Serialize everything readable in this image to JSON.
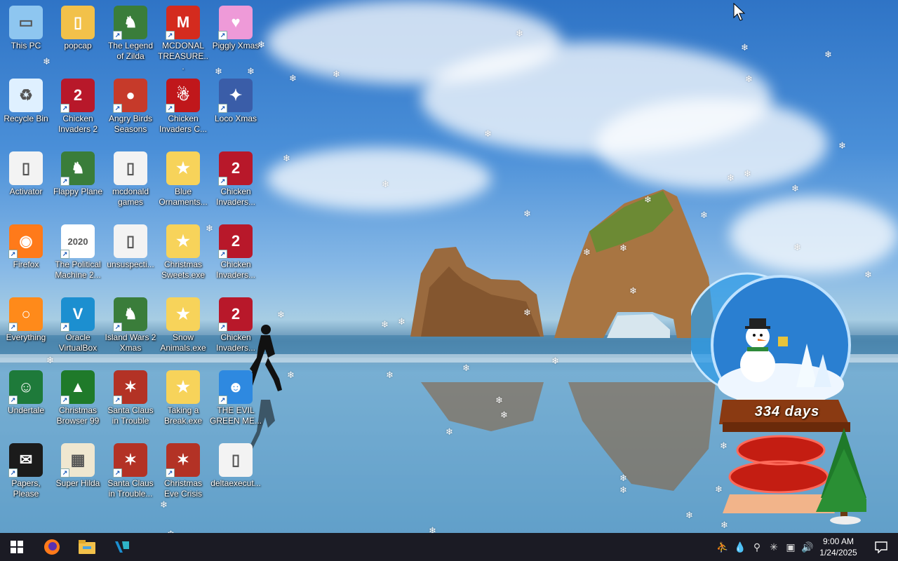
{
  "desktop": {
    "icons": [
      {
        "label": "This PC",
        "icon": "computer-icon",
        "shortcut": false
      },
      {
        "label": "popcap",
        "icon": "folder-icon",
        "shortcut": false
      },
      {
        "label": "The Legend of Zilda",
        "icon": "game-icon",
        "shortcut": true
      },
      {
        "label": "MCDONAL TREASURE...",
        "icon": "mcdonalds-icon",
        "shortcut": true
      },
      {
        "label": "Piggly Xmas",
        "icon": "pig-icon",
        "shortcut": true
      },
      {
        "label": "Recycle Bin",
        "icon": "recycle-bin-icon",
        "shortcut": false
      },
      {
        "label": "Chicken Invaders 2",
        "icon": "chicken-icon",
        "shortcut": true
      },
      {
        "label": "Angry Birds Seasons",
        "icon": "angry-bird-icon",
        "shortcut": true
      },
      {
        "label": "Chicken Invaders C...",
        "icon": "snowman-icon",
        "shortcut": true
      },
      {
        "label": "Loco Xmas",
        "icon": "bear-icon",
        "shortcut": true
      },
      {
        "label": "Activator",
        "icon": "file-icon",
        "shortcut": false
      },
      {
        "label": "Flappy Plane",
        "icon": "game-icon",
        "shortcut": true
      },
      {
        "label": "mcdonald games",
        "icon": "file-icon",
        "shortcut": false
      },
      {
        "label": "Blue Ornaments...",
        "icon": "installer-icon",
        "shortcut": false
      },
      {
        "label": "Chicken Invaders...",
        "icon": "chicken-icon",
        "shortcut": true
      },
      {
        "label": "Firefox",
        "icon": "firefox-icon",
        "shortcut": true
      },
      {
        "label": "The Political Machine 2...",
        "icon": "political-icon",
        "shortcut": true
      },
      {
        "label": "unsuspecti...",
        "icon": "file-icon",
        "shortcut": false
      },
      {
        "label": "Christmas Sweets.exe",
        "icon": "installer-icon",
        "shortcut": false
      },
      {
        "label": "Chicken Invaders...",
        "icon": "chicken-icon",
        "shortcut": true
      },
      {
        "label": "Everything",
        "icon": "search-icon",
        "shortcut": true
      },
      {
        "label": "Oracle VirtualBox",
        "icon": "virtualbox-icon",
        "shortcut": true
      },
      {
        "label": "Island Wars 2 Xmas",
        "icon": "game-icon",
        "shortcut": true
      },
      {
        "label": "Snow Animals.exe",
        "icon": "installer-icon",
        "shortcut": false
      },
      {
        "label": "Chicken Invaders...",
        "icon": "chicken-icon",
        "shortcut": true
      },
      {
        "label": "Undertale",
        "icon": "undertale-icon",
        "shortcut": true
      },
      {
        "label": "Christmas Browser 99",
        "icon": "tree-icon",
        "shortcut": true
      },
      {
        "label": "Santa Claus in Trouble",
        "icon": "santa-icon",
        "shortcut": true
      },
      {
        "label": "Taking a Break.exe",
        "icon": "installer-icon",
        "shortcut": false
      },
      {
        "label": "THE EVIL GREEN ME...",
        "icon": "messenger-icon",
        "shortcut": true
      },
      {
        "label": "Papers, Please",
        "icon": "papers-icon",
        "shortcut": true
      },
      {
        "label": "Super Hilda",
        "icon": "pixel-icon",
        "shortcut": true
      },
      {
        "label": "Santa Claus in Trouble...",
        "icon": "santa-icon",
        "shortcut": true
      },
      {
        "label": "Christmas Eve Crisis",
        "icon": "santa-icon",
        "shortcut": true
      },
      {
        "label": "deltaexecut...",
        "icon": "file-icon",
        "shortcut": false
      }
    ]
  },
  "widget": {
    "days_text": "334 days"
  },
  "taskbar": {
    "pinned": [
      {
        "icon": "windows-start-icon"
      },
      {
        "icon": "firefox-icon"
      },
      {
        "icon": "file-explorer-icon"
      },
      {
        "icon": "virtualbox-icon"
      }
    ],
    "tray": [
      "people-icon",
      "droplet-icon",
      "search-icon",
      "snowflake-icon",
      "network-icon",
      "volume-icon"
    ],
    "clock": {
      "time": "9:00 AM",
      "date": "1/24/2025"
    }
  }
}
